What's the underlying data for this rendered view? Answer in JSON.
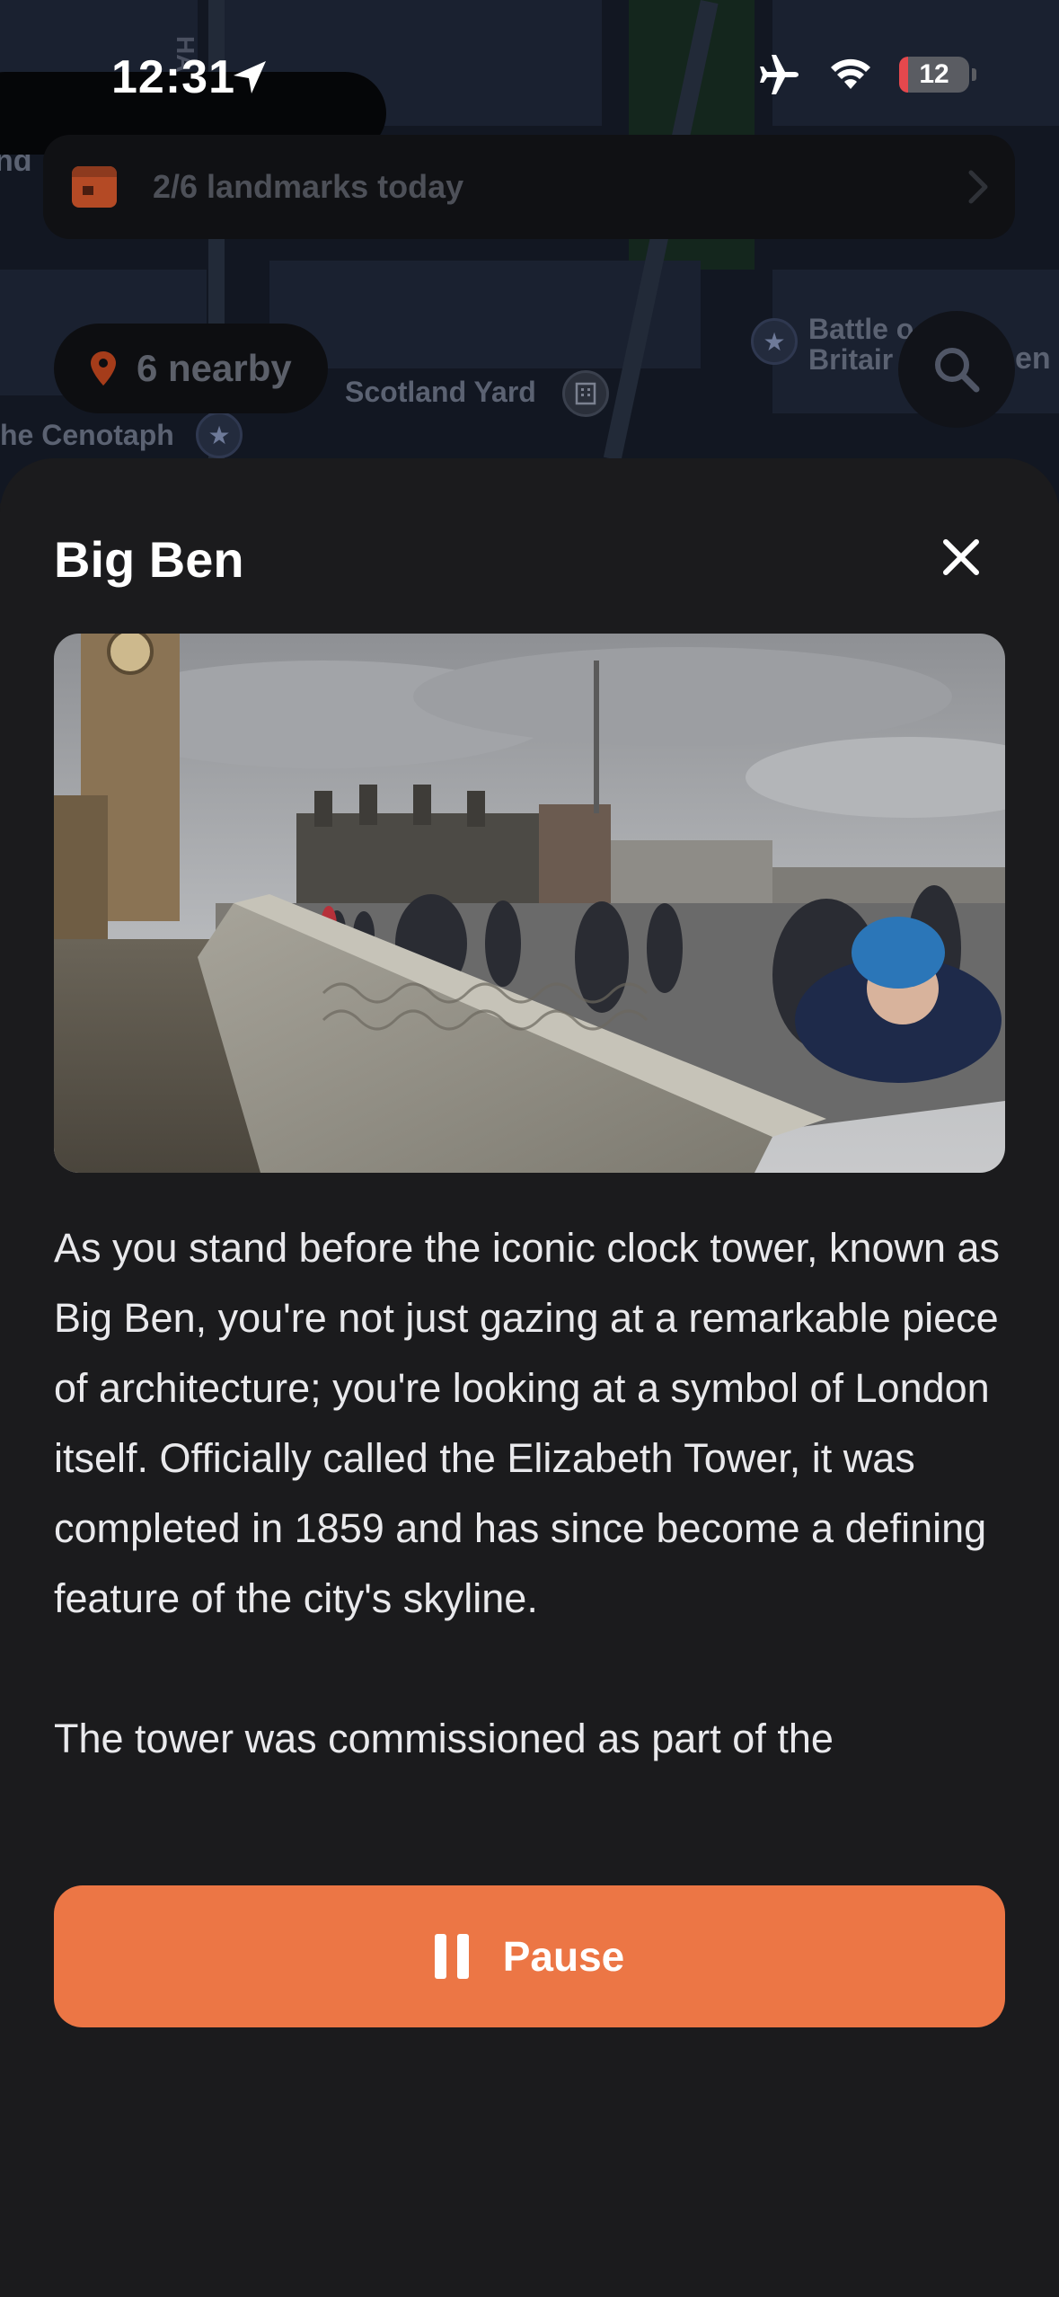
{
  "status_bar": {
    "time": "12:31",
    "battery": "12"
  },
  "map": {
    "today_banner": "2/6 landmarks today",
    "nearby_chip": "6 nearby",
    "labels": {
      "scotland_yard": "Scotland Yard",
      "cenotaph": "he Cenotaph",
      "battle_britain_1": "Battle o",
      "battle_britain_2": "Britair",
      "edge_right": "en",
      "edge_left": "nd",
      "street": "HAL"
    }
  },
  "sheet": {
    "title": "Big Ben",
    "paragraphs": [
      "As you stand before the iconic clock tower, known as Big Ben, you're not just gazing at a remarkable piece of architecture; you're looking at a symbol of London itself. Officially called the Elizabeth Tower, it was completed in 1859 and has since become a defining feature of the city's skyline.",
      "The tower was commissioned as part of the"
    ],
    "pause_label": "Pause"
  },
  "colors": {
    "accent": "#ec7645",
    "sheet_bg": "#1b1b1d",
    "map_bg": "#121722"
  },
  "icons": [
    "location-arrow-icon",
    "airplane-icon",
    "wifi-icon",
    "battery-icon",
    "calendar-icon",
    "chevron-right-icon",
    "map-pin-icon",
    "search-icon",
    "close-icon",
    "pause-icon",
    "star-icon",
    "building-icon"
  ]
}
